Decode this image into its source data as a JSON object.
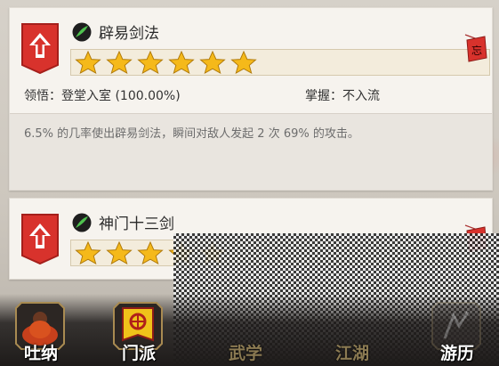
{
  "skills": [
    {
      "name": "辟易剑法",
      "stars_filled": 6,
      "stars_total": 6,
      "comprehension_label": "领悟",
      "comprehension_value": "登堂入室 (100.00%)",
      "mastery_label": "掌握",
      "mastery_value": "不入流",
      "description": "6.5% 的几率使出辟易剑法，瞬间对敌人发起 2 次 69% 的攻击。",
      "seal_text": "忘"
    },
    {
      "name": "神门十三剑",
      "stars_filled": 5,
      "stars_total": 5,
      "seal_text": "忘"
    }
  ],
  "nav": [
    {
      "label": "吐纳",
      "active": true
    },
    {
      "label": "门派",
      "active": true
    },
    {
      "label": "武学",
      "active": false
    },
    {
      "label": "江湖",
      "active": false
    },
    {
      "label": "游历",
      "active": false
    }
  ],
  "colors": {
    "badge_red": "#d8322c",
    "star_gold": "#f5b91a",
    "card_bg": "#f6f3ee"
  }
}
